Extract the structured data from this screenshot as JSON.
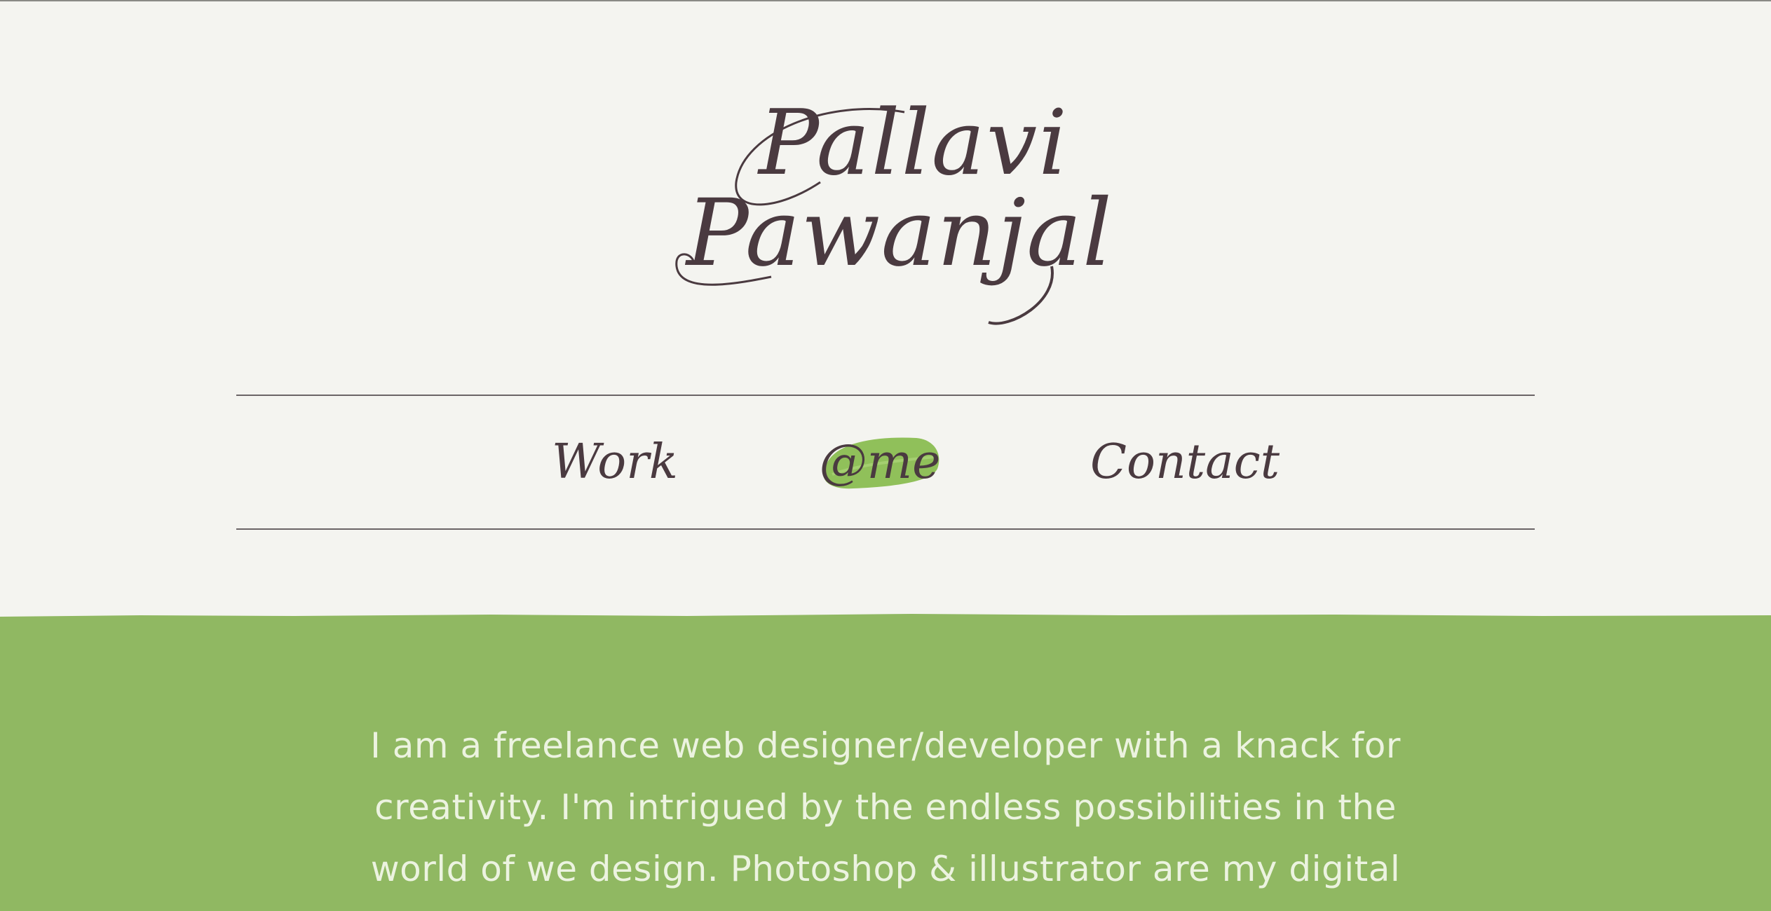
{
  "logo": {
    "first_name": "Pallavi",
    "last_name": "Pawanjal"
  },
  "nav": {
    "items": [
      {
        "label": "Work",
        "active": false
      },
      {
        "label": "@me",
        "active": true
      },
      {
        "label": "Contact",
        "active": false
      }
    ]
  },
  "intro": {
    "lines": [
      "I am a freelance web designer/developer with a knack for",
      "creativity. I'm intrigued by the endless possibilities in the",
      "world of we design. Photoshop & illustrator are my digital"
    ]
  },
  "colors": {
    "ink": "#4a3a40",
    "paper": "#f4f4f0",
    "accent_green": "#90b862",
    "intro_text": "#ecf3e0"
  }
}
